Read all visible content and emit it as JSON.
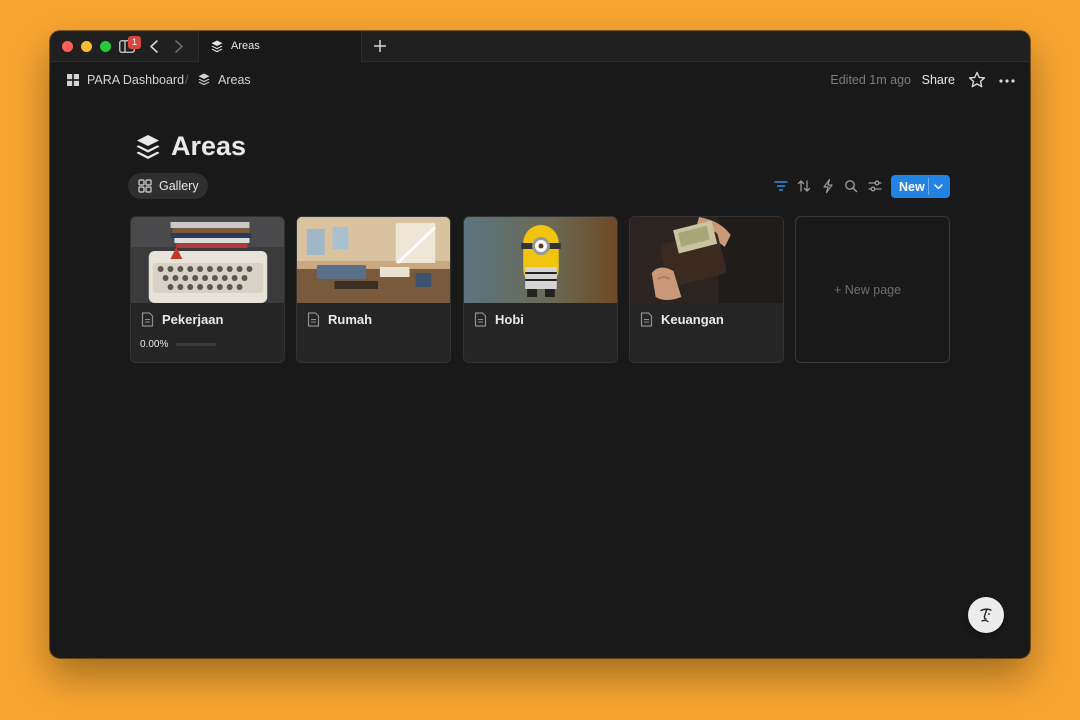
{
  "browser": {
    "sidebar_badge": "1",
    "tab_title": "Areas"
  },
  "breadcrumb": {
    "items": [
      "PARA Dashboard",
      "Areas"
    ],
    "separator": "/"
  },
  "topbar": {
    "edited": "Edited 1m ago",
    "share": "Share"
  },
  "page": {
    "title": "Areas",
    "view_tab": "Gallery",
    "new_button": "New"
  },
  "toolbar": {
    "icons": [
      "filter-icon",
      "sort-icon",
      "automation-icon",
      "search-icon",
      "settings-icon"
    ]
  },
  "cards": [
    {
      "title": "Pekerjaan",
      "progress": "0.00%",
      "cover": "typewriter-photo"
    },
    {
      "title": "Rumah",
      "cover": "living-room-photo"
    },
    {
      "title": "Hobi",
      "cover": "minion-photo"
    },
    {
      "title": "Keuangan",
      "cover": "wallet-photo"
    }
  ],
  "new_page": "+ New page",
  "colors": {
    "accent": "#2383e2",
    "background": "#191919",
    "card": "#252525",
    "desktop": "#f7a531"
  }
}
